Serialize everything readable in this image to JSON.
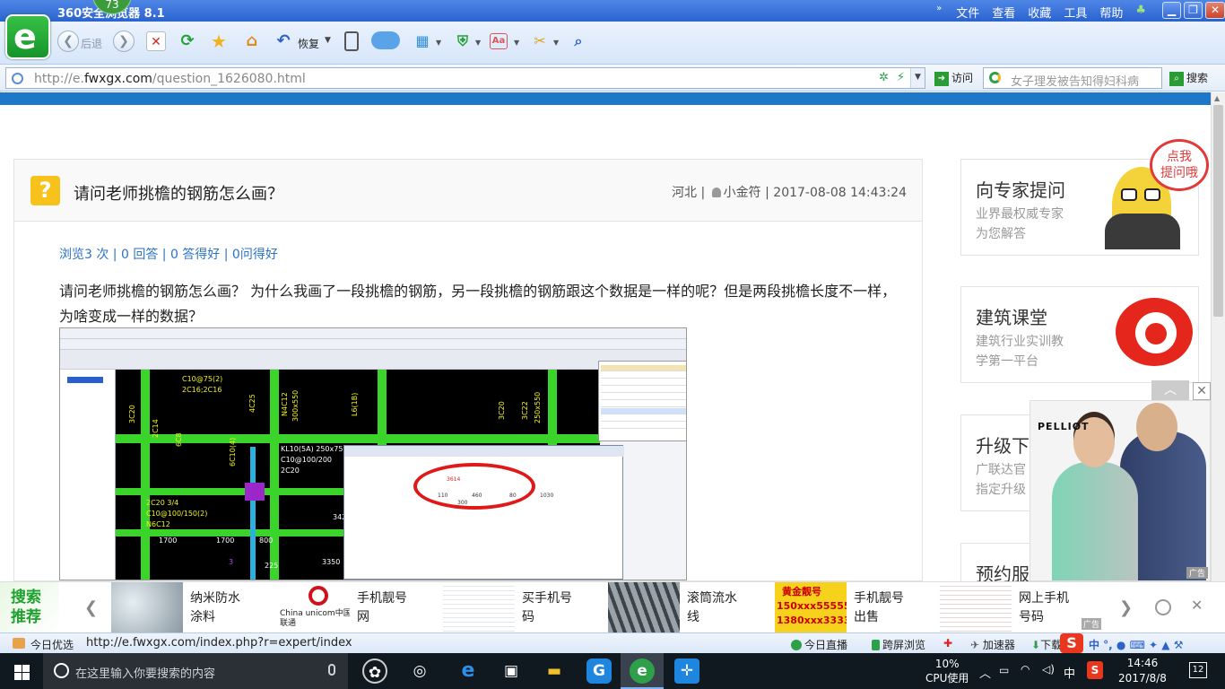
{
  "browser": {
    "app_name": "360安全浏览器 8.1",
    "badge": "73",
    "menu": [
      "文件",
      "查看",
      "收藏",
      "工具",
      "帮助"
    ],
    "nav": {
      "back": "后退",
      "restore": "恢复"
    },
    "url": {
      "prefix": "http://e.",
      "domain": "fwxgx.com",
      "path": "/question_1626080.html"
    },
    "visit_label": "访问",
    "search_placeholder": "女子理发被告知得妇科病",
    "search_label": "搜索"
  },
  "question": {
    "title": "请问老师挑檐的钢筋怎么画？",
    "region": "河北",
    "user": "小金符",
    "datetime": "2017-08-08 14:43:24",
    "stats": "浏览3 次 | 0 回答 | 0 答得好 | 0问得好",
    "body": "请问老师挑檐的钢筋怎么画？ 为什么我画了一段挑檐的钢筋，另一段挑檐的钢筋跟这个数据是一样的呢？但是两段挑檐长度不一样，为啥变成一样的数据？"
  },
  "screenshot_labels": {
    "l1": "C10@75(2)",
    "l2": "2C16;2C16",
    "l3": "KL10(5A) 250x75",
    "l4": "C10@100/200",
    "l5": "2C20",
    "l6": "2C20 3/4",
    "l7": "C10@100/150(2)",
    "l8": "N6C12",
    "d1": "1700",
    "d2": "1700",
    "d3": "800",
    "d4": "3425",
    "d5": "225",
    "d6": "3350",
    "d7": "3",
    "v1": "3C20",
    "v2": "2C14",
    "v3": "6C8",
    "v4": "4C25",
    "v5": "N4C12",
    "v6": "300x550",
    "v7": "6C10(4)",
    "v8": "L6(1B)",
    "v9": "3C20",
    "v10": "3C22",
    "v11": "250x550",
    "dlg1": "3614",
    "dlg2": "460",
    "dlg3": "80",
    "dlg4": "110",
    "dlg5": "300",
    "dlg6": "1030"
  },
  "sidebar": {
    "expert": {
      "title": "向专家提问",
      "sub1": "业界最权威专家",
      "sub2": "为您解答",
      "bubble1": "点我",
      "bubble2": "提问哦"
    },
    "course": {
      "title": "建筑课堂",
      "sub1": "建筑行业实训教",
      "sub2": "学第一平台"
    },
    "upgrade": {
      "title": "升级下",
      "sub1": "广联达官",
      "sub2": "指定升级"
    },
    "reserve": {
      "title": "预约服"
    },
    "ad": {
      "brand": "PELLIOT",
      "tag": "广告"
    }
  },
  "recommend": {
    "tag": "搜索推荐",
    "items": [
      {
        "l1": "纳米防水",
        "l2": "涂料"
      },
      {
        "l1": "手机靓号",
        "l2": "网",
        "logo": "China unicom中国联通"
      },
      {
        "l1": "买手机号",
        "l2": "码"
      },
      {
        "l1": "滚筒流水",
        "l2": "线"
      },
      {
        "l1": "手机靓号",
        "l2": "出售",
        "img1": "黄金靓号",
        "img2": "150xxx55555",
        "img3": "1380xxx3333"
      },
      {
        "l1": "网上手机",
        "l2": "号码"
      }
    ],
    "ad_tag": "广告"
  },
  "statusbar": {
    "today": "今日优选",
    "link": "http://e.fwxgx.com/index.php?r=expert/index",
    "live": "今日直播",
    "cross": "跨屏浏览",
    "accel": "加速器",
    "download": "下载"
  },
  "taskbar": {
    "search_placeholder": "在这里输入你要搜索的内容",
    "cpu_pct": "10%",
    "cpu_label": "CPU使用",
    "ime": "中",
    "time": "14:46",
    "date": "2017/8/8",
    "notifications": "12"
  }
}
